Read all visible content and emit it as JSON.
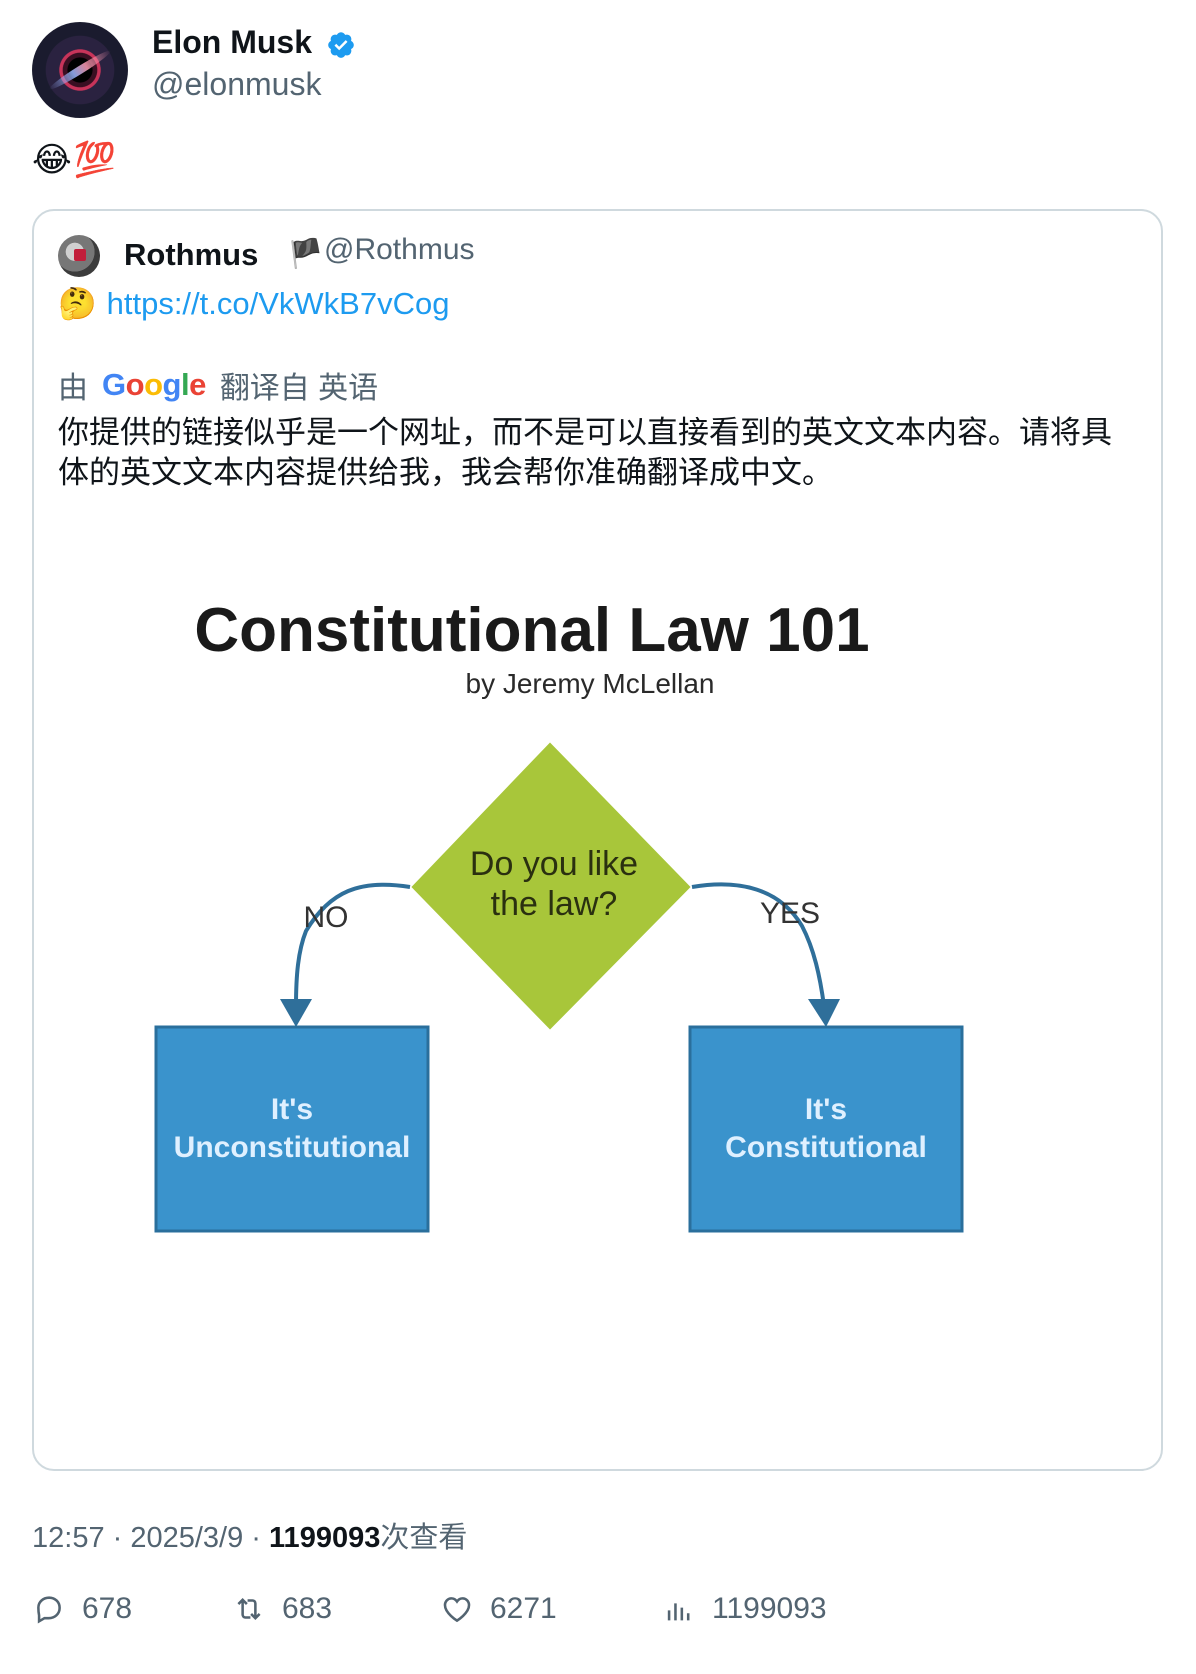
{
  "author": {
    "name": "Elon Musk",
    "handle": "@elonmusk",
    "verified_icon": "verified-badge-icon"
  },
  "tweet": {
    "text": "😂💯"
  },
  "quote": {
    "name": "Rothmus",
    "flag": "🏴",
    "handle": "@Rothmus",
    "emoji": "🤔",
    "link": "https://t.co/VkWkB7vCog",
    "translated_by_prefix": "由",
    "google_logo": "Google",
    "translated_from": "翻译自 英语",
    "translation": "你提供的链接似乎是一个网址，而不是可以直接看到的英文文本内容。请将具体的英文文本内容提供给我，我会帮你准确翻译成中文。",
    "figure": {
      "title": "Constitutional Law 101",
      "subtitle": "by Jeremy McLellan",
      "question_line1": "Do you like",
      "question_line2": "the law?",
      "no_label": "NO",
      "yes_label": "YES",
      "left_box_line1": "It's",
      "left_box_line2": "Unconstitutional",
      "right_box_line1": "It's",
      "right_box_line2": "Constitutional",
      "diamond_color": "#a8c63a",
      "box_color": "#3a93cc"
    }
  },
  "meta": {
    "time": "12:57",
    "sep1": " · ",
    "date": "2025/3/9",
    "sep2": " · ",
    "views": "1199093",
    "views_suffix": "次查看"
  },
  "actions": {
    "replies": "678",
    "reposts": "683",
    "likes": "6271",
    "views": "1199093"
  }
}
